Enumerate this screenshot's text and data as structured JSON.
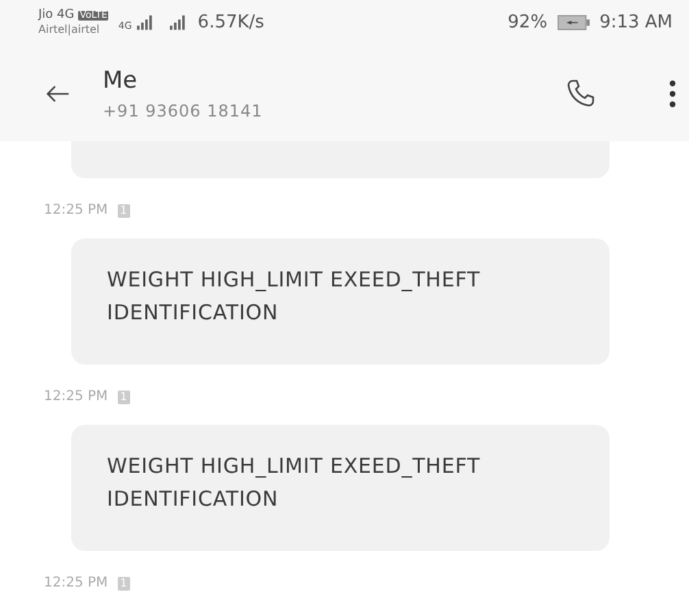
{
  "status_bar": {
    "carrier_1": "Jio 4G",
    "volte": "VoLTE",
    "carrier_2": "Airtel|airtel",
    "network": "4G",
    "speed": "6.57K/s",
    "battery": "92%",
    "charging": true,
    "time": "9:13 AM"
  },
  "header": {
    "title": "Me",
    "subtitle": "+91 93606 18141"
  },
  "messages": [
    {
      "kind": "cut",
      "time": "12:25 PM",
      "sim": "1"
    },
    {
      "kind": "full",
      "text": "WEIGHT HIGH_LIMIT EXEED_THEFT IDENTIFICATION",
      "time": "12:25 PM",
      "sim": "1"
    },
    {
      "kind": "full",
      "text": "WEIGHT HIGH_LIMIT EXEED_THEFT IDENTIFICATION",
      "time": "12:25 PM",
      "sim": "1"
    }
  ]
}
